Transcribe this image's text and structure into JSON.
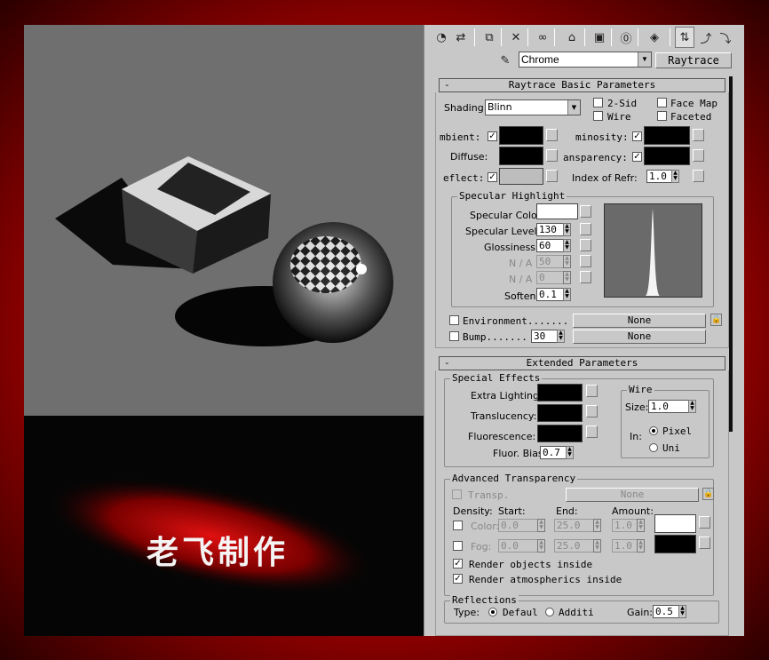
{
  "toolbar": {
    "icons": [
      "get-material-icon",
      "put-to-scene-icon",
      "assign-material-icon",
      "delete-icon",
      "make-unique-icon",
      "put-to-library-icon",
      "material-effects-channel-icon",
      "show-map-icon",
      "show-end-result-icon",
      "go-to-parent-icon",
      "go-forward-icon",
      "pick-material-icon"
    ]
  },
  "material": {
    "name": "Chrome",
    "type_button": "Raytrace"
  },
  "basic": {
    "title": "Raytrace Basic Parameters",
    "shading_label": "Shading:",
    "shading_value": "Blinn",
    "two_sided": "2-Sid",
    "wire": "Wire",
    "face_map": "Face Map",
    "faceted": "Faceted",
    "ambient": "mbient:",
    "luminosity": "minosity:",
    "diffuse": "Diffuse:",
    "transparency": "ansparency:",
    "reflect": "eflect:",
    "index_refr_label": "Index of Refr:",
    "index_refr_value": "1.0",
    "specular": {
      "title": "Specular Highlight",
      "color_label": "Specular Color",
      "level_label": "Specular Level:",
      "level_value": "130",
      "gloss_label": "Glossiness:",
      "gloss_value": "60",
      "na1_label": "N / A",
      "na1_value": "50",
      "na2_label": "N / A",
      "na2_value": "0",
      "soften_label": "Soften",
      "soften_value": "0.1"
    },
    "environment_label": "Environment.......",
    "environment_map": "None",
    "bump_label": "Bump.......",
    "bump_value": "30",
    "bump_map": "None"
  },
  "extended": {
    "title": "Extended Parameters",
    "special": {
      "title": "Special Effects",
      "extra_lighting": "Extra Lighting:",
      "translucency": "Translucency:",
      "fluorescence": "Fluorescence:",
      "fluor_bias_label": "Fluor. Bias:",
      "fluor_bias_value": "0.7"
    },
    "wire": {
      "title": "Wire",
      "size_label": "Size:",
      "size_value": "1.0",
      "in_label": "In:",
      "pixels": "Pixel",
      "units": "Uni"
    },
    "adv_transp": {
      "title": "Advanced Transparency",
      "transp_label": "Transp.",
      "transp_map": "None",
      "density": "Density:",
      "start": "Start:",
      "end": "End:",
      "amount": "Amount:",
      "color_label": "Color:",
      "color_start": "0.0",
      "color_end": "25.0",
      "color_amount": "1.0",
      "fog_label": "Fog:",
      "fog_start": "0.0",
      "fog_end": "25.0",
      "fog_amount": "1.0",
      "render_objects": "Render objects inside",
      "render_atmos": "Render atmospherics inside"
    },
    "reflections": {
      "title": "Reflections",
      "type_label": "Type:",
      "default": "Defaul",
      "additive": "Additi",
      "gain_label": "Gain:",
      "gain_value": "0.5"
    }
  },
  "watermark": "老飞制作",
  "colors": {
    "frame_red": "#d00000",
    "panel_gray": "#c8c8c8",
    "render_gray": "#6f6f6f"
  }
}
